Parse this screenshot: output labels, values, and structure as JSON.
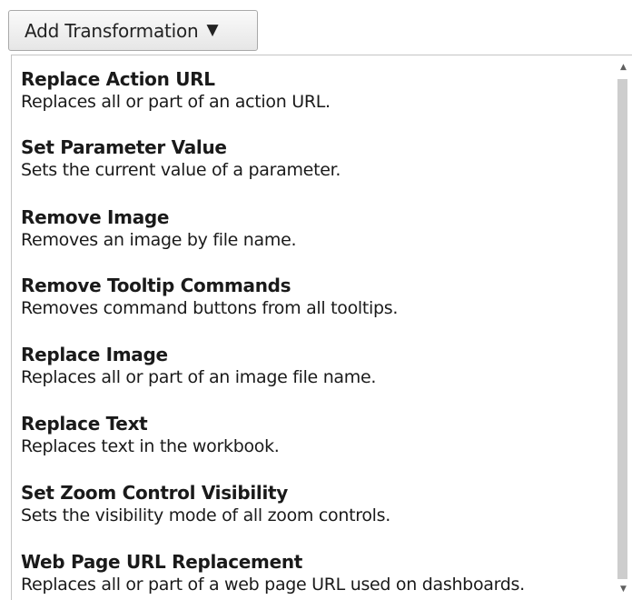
{
  "add_button": {
    "label": "Add Transformation",
    "caret_glyph": "▼",
    "caret_icon": "caret-down-icon"
  },
  "menu": {
    "items": [
      {
        "title": "Replace Action URL",
        "description": "Replaces all or part of an action URL."
      },
      {
        "title": "Set Parameter Value",
        "description": "Sets the current value of a parameter."
      },
      {
        "title": "Remove Image",
        "description": "Removes an image by file name."
      },
      {
        "title": "Remove Tooltip Commands",
        "description": "Removes command buttons from all tooltips."
      },
      {
        "title": "Replace Image",
        "description": "Replaces all or part of an image file name."
      },
      {
        "title": "Replace Text",
        "description": "Replaces text in the workbook."
      },
      {
        "title": "Set Zoom Control Visibility",
        "description": "Sets the visibility mode of all zoom controls."
      },
      {
        "title": "Web Page URL Replacement",
        "description": "Replaces all or part of a web page URL used on dashboards."
      }
    ]
  },
  "scrollbar": {
    "up_glyph": "▲",
    "down_glyph": "▼",
    "up_icon": "scroll-up-arrow-icon",
    "down_icon": "scroll-down-arrow-icon"
  }
}
